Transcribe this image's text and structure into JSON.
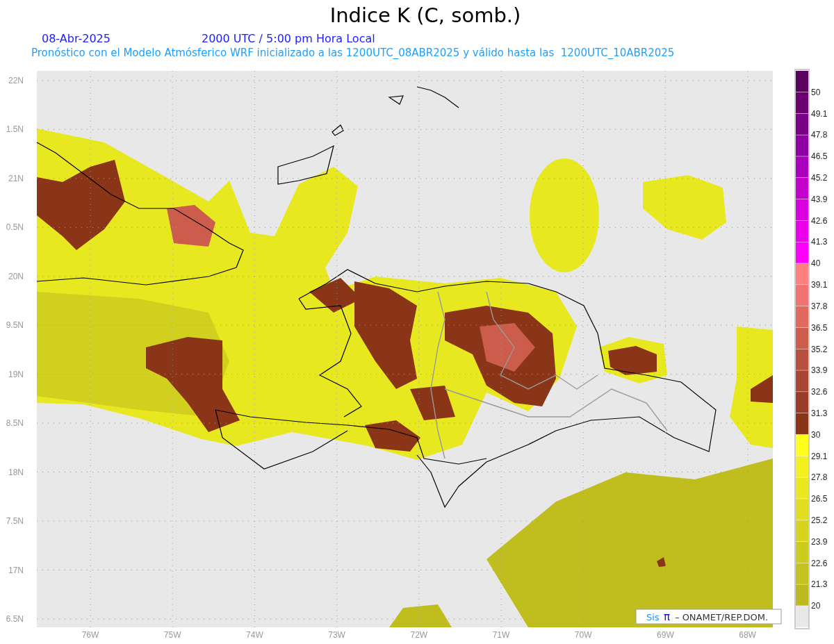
{
  "title": "Indice K (C, somb.)",
  "date": "08-Abr-2025",
  "time": "2000 UTC / 5:00 pm Hora Local",
  "subtitle": "Pronóstico con el Modelo Atmósferico WRF inicializado a las 1200UTC_08ABR2025 y válido hasta las  1200UTC_10ABR2025",
  "lat_labels": [
    "22N",
    "1.5N",
    "21N",
    "0.5N",
    "20N",
    "9.5N",
    "19N",
    "8.5N",
    "18N",
    "7.5N",
    "17N",
    "6.5N"
  ],
  "lon_labels": [
    "76W",
    "75W",
    "74W",
    "73W",
    "72W",
    "71W",
    "70W",
    "69W",
    "68W"
  ],
  "colorbar": [
    {
      "color": "#5c005f",
      "label": "50"
    },
    {
      "color": "#6a0070",
      "label": "49.1"
    },
    {
      "color": "#7a0085",
      "label": "47.8"
    },
    {
      "color": "#9000a5",
      "label": "46.5"
    },
    {
      "color": "#a800bb",
      "label": "45.2"
    },
    {
      "color": "#c400cc",
      "label": "43.9"
    },
    {
      "color": "#d800dc",
      "label": "42.6"
    },
    {
      "color": "#e800e8",
      "label": "41.3"
    },
    {
      "color": "#ff00ff",
      "label": "40"
    },
    {
      "color": "#ff8080",
      "label": "39.1"
    },
    {
      "color": "#f07272",
      "label": "37.8"
    },
    {
      "color": "#e06a60",
      "label": "36.5"
    },
    {
      "color": "#cc5c4c",
      "label": "35.2"
    },
    {
      "color": "#b85040",
      "label": "33.9"
    },
    {
      "color": "#a84535",
      "label": "32.6"
    },
    {
      "color": "#9a3a28",
      "label": "31.3"
    },
    {
      "color": "#8a3418",
      "label": "30"
    },
    {
      "color": "#ffff1e",
      "label": "29.1"
    },
    {
      "color": "#f2f01e",
      "label": "27.8"
    },
    {
      "color": "#eae81e",
      "label": "26.5"
    },
    {
      "color": "#e0de1e",
      "label": "25.2"
    },
    {
      "color": "#d6d41e",
      "label": "23.9"
    },
    {
      "color": "#cccc1e",
      "label": "22.6"
    },
    {
      "color": "#c4c21e",
      "label": "21.3"
    },
    {
      "color": "#bcba1e",
      "label": "20"
    },
    {
      "color": "#e8e8e8"
    }
  ],
  "credit": {
    "logo_text": "Sis",
    "logo_symbol": "π",
    "text": "– ONAMET/REP.DOM."
  }
}
